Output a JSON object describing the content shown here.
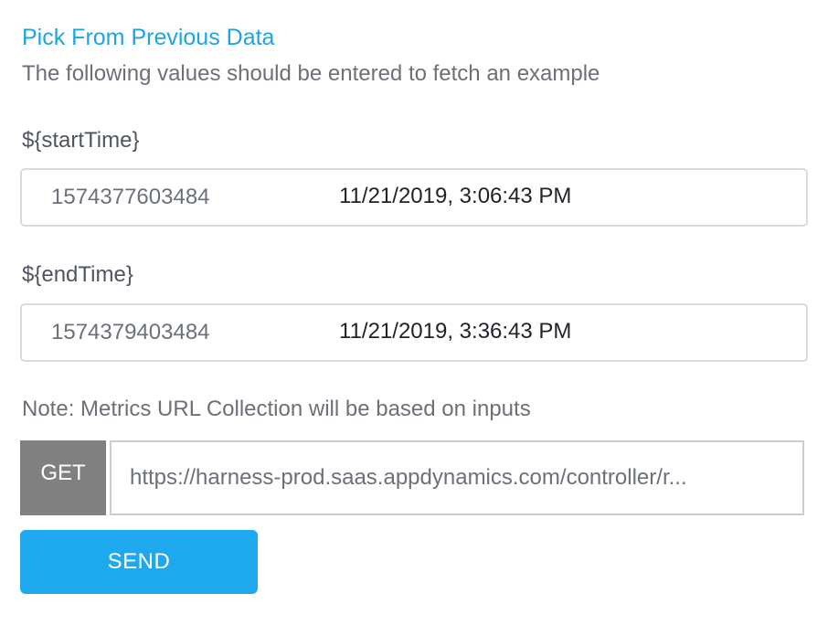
{
  "pick_link": "Pick From Previous Data",
  "subtitle": "The following values should be entered to fetch an example",
  "fields": [
    {
      "label": "${startTime}",
      "value": "1574377603484",
      "date": "11/21/2019, 3:06:43 PM"
    },
    {
      "label": "${endTime}",
      "value": "1574379403484",
      "date": "11/21/2019, 3:36:43 PM"
    }
  ],
  "note": "Note: Metrics URL Collection will be based on inputs",
  "request": {
    "method": "GET",
    "url": "https://harness-prod.saas.appdynamics.com/controller/r..."
  },
  "send_label": "SEND",
  "colors": {
    "accent": "#1ea8ee",
    "link": "#1ea4e0",
    "method_bg": "#808080"
  }
}
